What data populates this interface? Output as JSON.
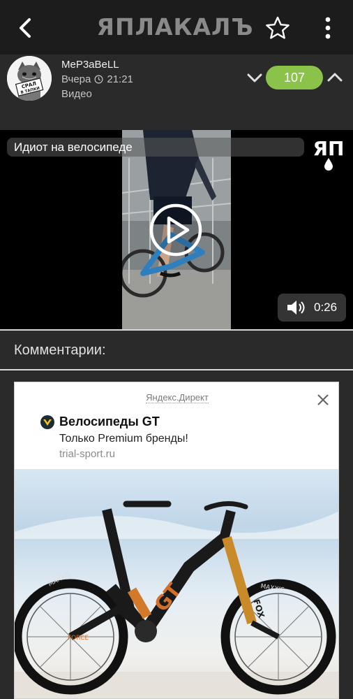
{
  "app": {
    "logo_text": "ЯПЛАКАЛЪ",
    "icons": {
      "back": "chevron-left-icon",
      "favorite": "star-outline-icon",
      "menu": "more-vertical-icon"
    }
  },
  "post": {
    "author": "MeP3aBeLL",
    "date": "Вчера",
    "time": "21:21",
    "category": "Видео",
    "rating": "107",
    "avatar_caption": "СРАЛ В ТАПКИ",
    "colors": {
      "rating_bg": "#8bc34a",
      "header_bg": "#1c1c1c",
      "page_bg": "#2a2a2a"
    }
  },
  "video": {
    "title": "Идиот на велосипеде",
    "watermark": "ЯП",
    "duration": "0:26"
  },
  "comments": {
    "heading": "Комментарии:"
  },
  "ad": {
    "source": "Яндекс.Директ",
    "headline": "Велосипеды GT",
    "text": "Только Premium бренды!",
    "domain": "trial-sport.ru",
    "image_lettering": [
      "FORCE",
      "MAXXIS",
      "GT",
      "FOX"
    ]
  }
}
